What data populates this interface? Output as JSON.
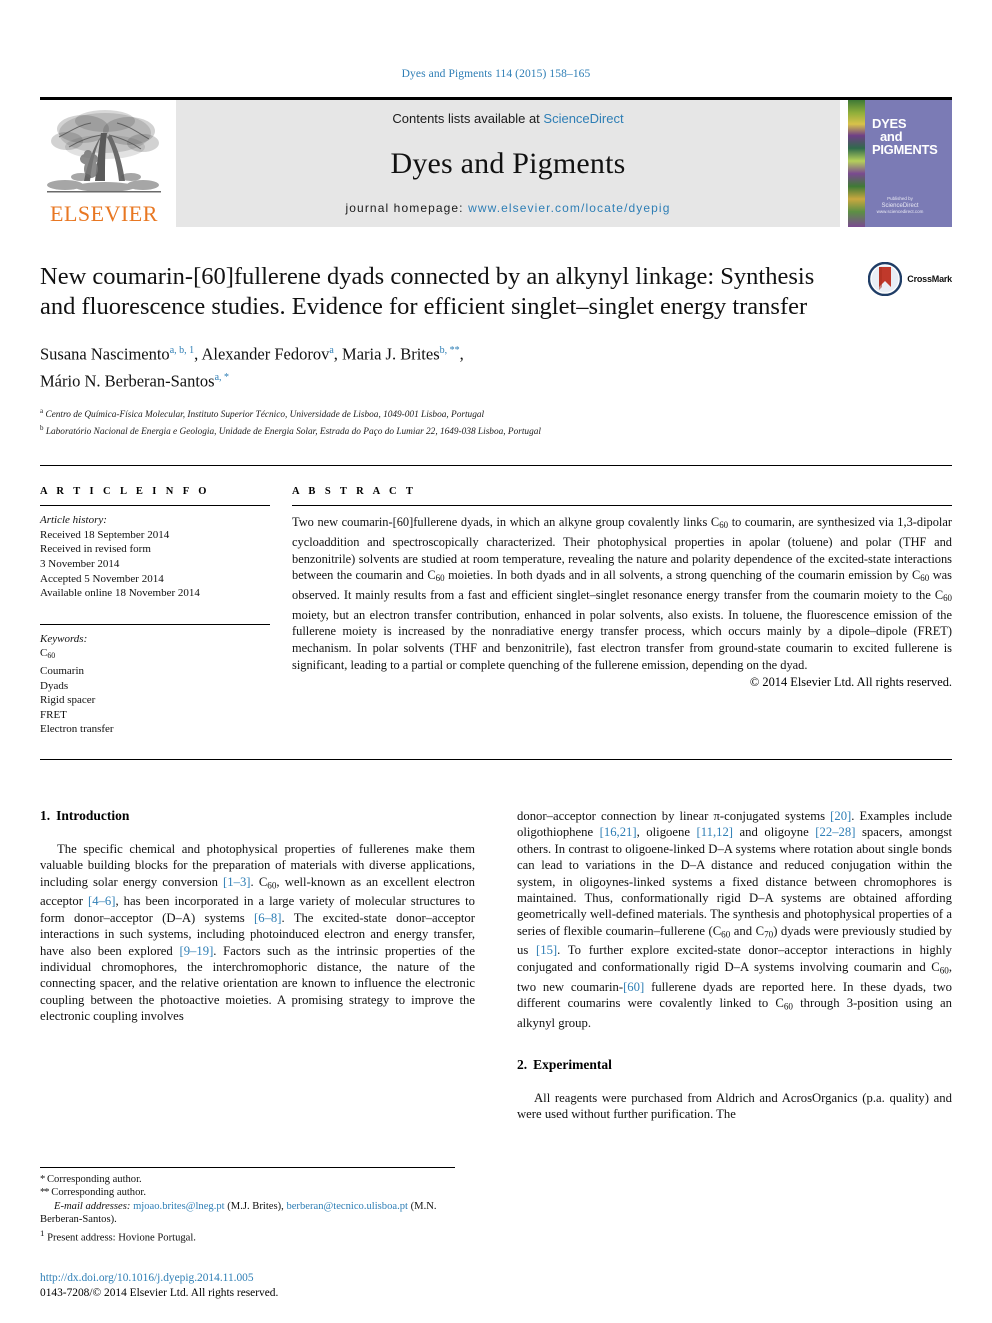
{
  "running_head": "Dyes and Pigments 114 (2015) 158–165",
  "masthead": {
    "publisher_wordmark": "ELSEVIER",
    "contents_line_prefix": "Contents lists available at ",
    "contents_link": "ScienceDirect",
    "journal_title": "Dyes and Pigments",
    "homepage_prefix": "journal homepage: ",
    "homepage_url": "www.elsevier.com/locate/dyepig",
    "cover": {
      "line1": "DYES",
      "line2": "and",
      "line3": "PIGMENTS",
      "published_by": "Published by",
      "imprint": "ScienceDirect",
      "imprint_sub": "www.sciencedirect.com"
    }
  },
  "article": {
    "title": "New coumarin-[60]fullerene dyads connected by an alkynyl linkage: Synthesis and fluorescence studies. Evidence for efficient singlet–singlet energy transfer",
    "crossmark_label": "CrossMark",
    "authors": [
      {
        "name": "Susana Nascimento",
        "marks": "a, b, 1"
      },
      {
        "name": "Alexander Fedorov",
        "marks": "a"
      },
      {
        "name": "Maria J. Brites",
        "marks": "b, **"
      },
      {
        "name": "Mário N. Berberan-Santos",
        "marks": "a, *"
      }
    ],
    "affiliations": [
      {
        "mark": "a",
        "text": "Centro de Química-Física Molecular, Instituto Superior Técnico, Universidade de Lisboa, 1049-001 Lisboa, Portugal"
      },
      {
        "mark": "b",
        "text": "Laboratório Nacional de Energia e Geologia, Unidade de Energia Solar, Estrada do Paço do Lumiar 22, 1649-038 Lisboa, Portugal"
      }
    ]
  },
  "article_info": {
    "heading": "A R T I C L E  I N F O",
    "history_label": "Article history:",
    "history": [
      "Received 18 September 2014",
      "Received in revised form",
      "3 November 2014",
      "Accepted 5 November 2014",
      "Available online 18 November 2014"
    ],
    "keywords_label": "Keywords:",
    "keywords": [
      "C60",
      "Coumarin",
      "Dyads",
      "Rigid spacer",
      "FRET",
      "Electron transfer"
    ]
  },
  "abstract": {
    "heading": "A B S T R A C T",
    "text": "Two new coumarin-[60]fullerene dyads, in which an alkyne group covalently links C60 to coumarin, are synthesized via 1,3-dipolar cycloaddition and spectroscopically characterized. Their photophysical properties in apolar (toluene) and polar (THF and benzonitrile) solvents are studied at room temperature, revealing the nature and polarity dependence of the excited-state interactions between the coumarin and C60 moieties. In both dyads and in all solvents, a strong quenching of the coumarin emission by C60 was observed. It mainly results from a fast and efficient singlet–singlet resonance energy transfer from the coumarin moiety to the C60 moiety, but an electron transfer contribution, enhanced in polar solvents, also exists. In toluene, the fluorescence emission of the fullerene moiety is increased by the nonradiative energy transfer process, which occurs mainly by a dipole–dipole (FRET) mechanism. In polar solvents (THF and benzonitrile), fast electron transfer from ground-state coumarin to excited fullerene is significant, leading to a partial or complete quenching of the fullerene emission, depending on the dyad.",
    "copyright": "© 2014 Elsevier Ltd. All rights reserved."
  },
  "sections": {
    "introduction": {
      "number": "1.",
      "title": "Introduction",
      "paragraph_left": "The specific chemical and photophysical properties of fullerenes make them valuable building blocks for the preparation of materials with diverse applications, including solar energy conversion [1–3]. C60, well-known as an excellent electron acceptor [4–6], has been incorporated in a large variety of molecular structures to form donor–acceptor (D–A) systems [6–8]. The excited-state donor–acceptor interactions in such systems, including photoinduced electron and energy transfer, have also been explored [9–19]. Factors such as the intrinsic properties of the individual chromophores, the interchromophoric distance, the nature of the connecting spacer, and the relative orientation are known to influence the electronic coupling between the photoactive moieties. A promising strategy to improve the electronic coupling involves",
      "paragraph_right": "donor–acceptor connection by linear π-conjugated systems [20]. Examples include oligothiophene [16,21], oligoene [11,12] and oligoyne [22–28] spacers, amongst others. In contrast to oligoene-linked D–A systems where rotation about single bonds can lead to variations in the D–A distance and reduced conjugation within the system, in oligoynes-linked systems a fixed distance between chromophores is maintained. Thus, conformationally rigid D–A systems are obtained affording geometrically well-defined materials. The synthesis and photophysical properties of a series of flexible coumarin–fullerene (C60 and C70) dyads were previously studied by us [15]. To further explore excited-state donor–acceptor interactions in highly conjugated and conformationally rigid D–A systems involving coumarin and C60, two new coumarin-[60] fullerene dyads are reported here. In these dyads, two different coumarins were covalently linked to C60 through 3-position using an alkynyl group."
    },
    "experimental": {
      "number": "2.",
      "title": "Experimental",
      "paragraph": "All reagents were purchased from Aldrich and AcrosOrganics (p.a. quality) and were used without further purification. The"
    }
  },
  "footnotes": {
    "corresponding_1_mark": "*",
    "corresponding_1": "Corresponding author.",
    "corresponding_2_mark": "**",
    "corresponding_2": "Corresponding author.",
    "email_label": "E-mail addresses:",
    "email_1": "mjoao.brites@lneg.pt",
    "email_1_owner": "(M.J. Brites),",
    "email_2": "berberan@tecnico.ulisboa.pt",
    "email_2_owner": "(M.N. Berberan-Santos).",
    "present_address_mark": "1",
    "present_address": "Present address: Hovione Portugal."
  },
  "doi_block": {
    "doi_url": "http://dx.doi.org/10.1016/j.dyepig.2014.11.005",
    "issn_line": "0143-7208/© 2014 Elsevier Ltd. All rights reserved."
  },
  "colors": {
    "link": "#2e7eb5",
    "elsevier_orange": "#e87722",
    "cover_purple": "#7b7bb5",
    "banner_gray": "#e6e6e6"
  }
}
